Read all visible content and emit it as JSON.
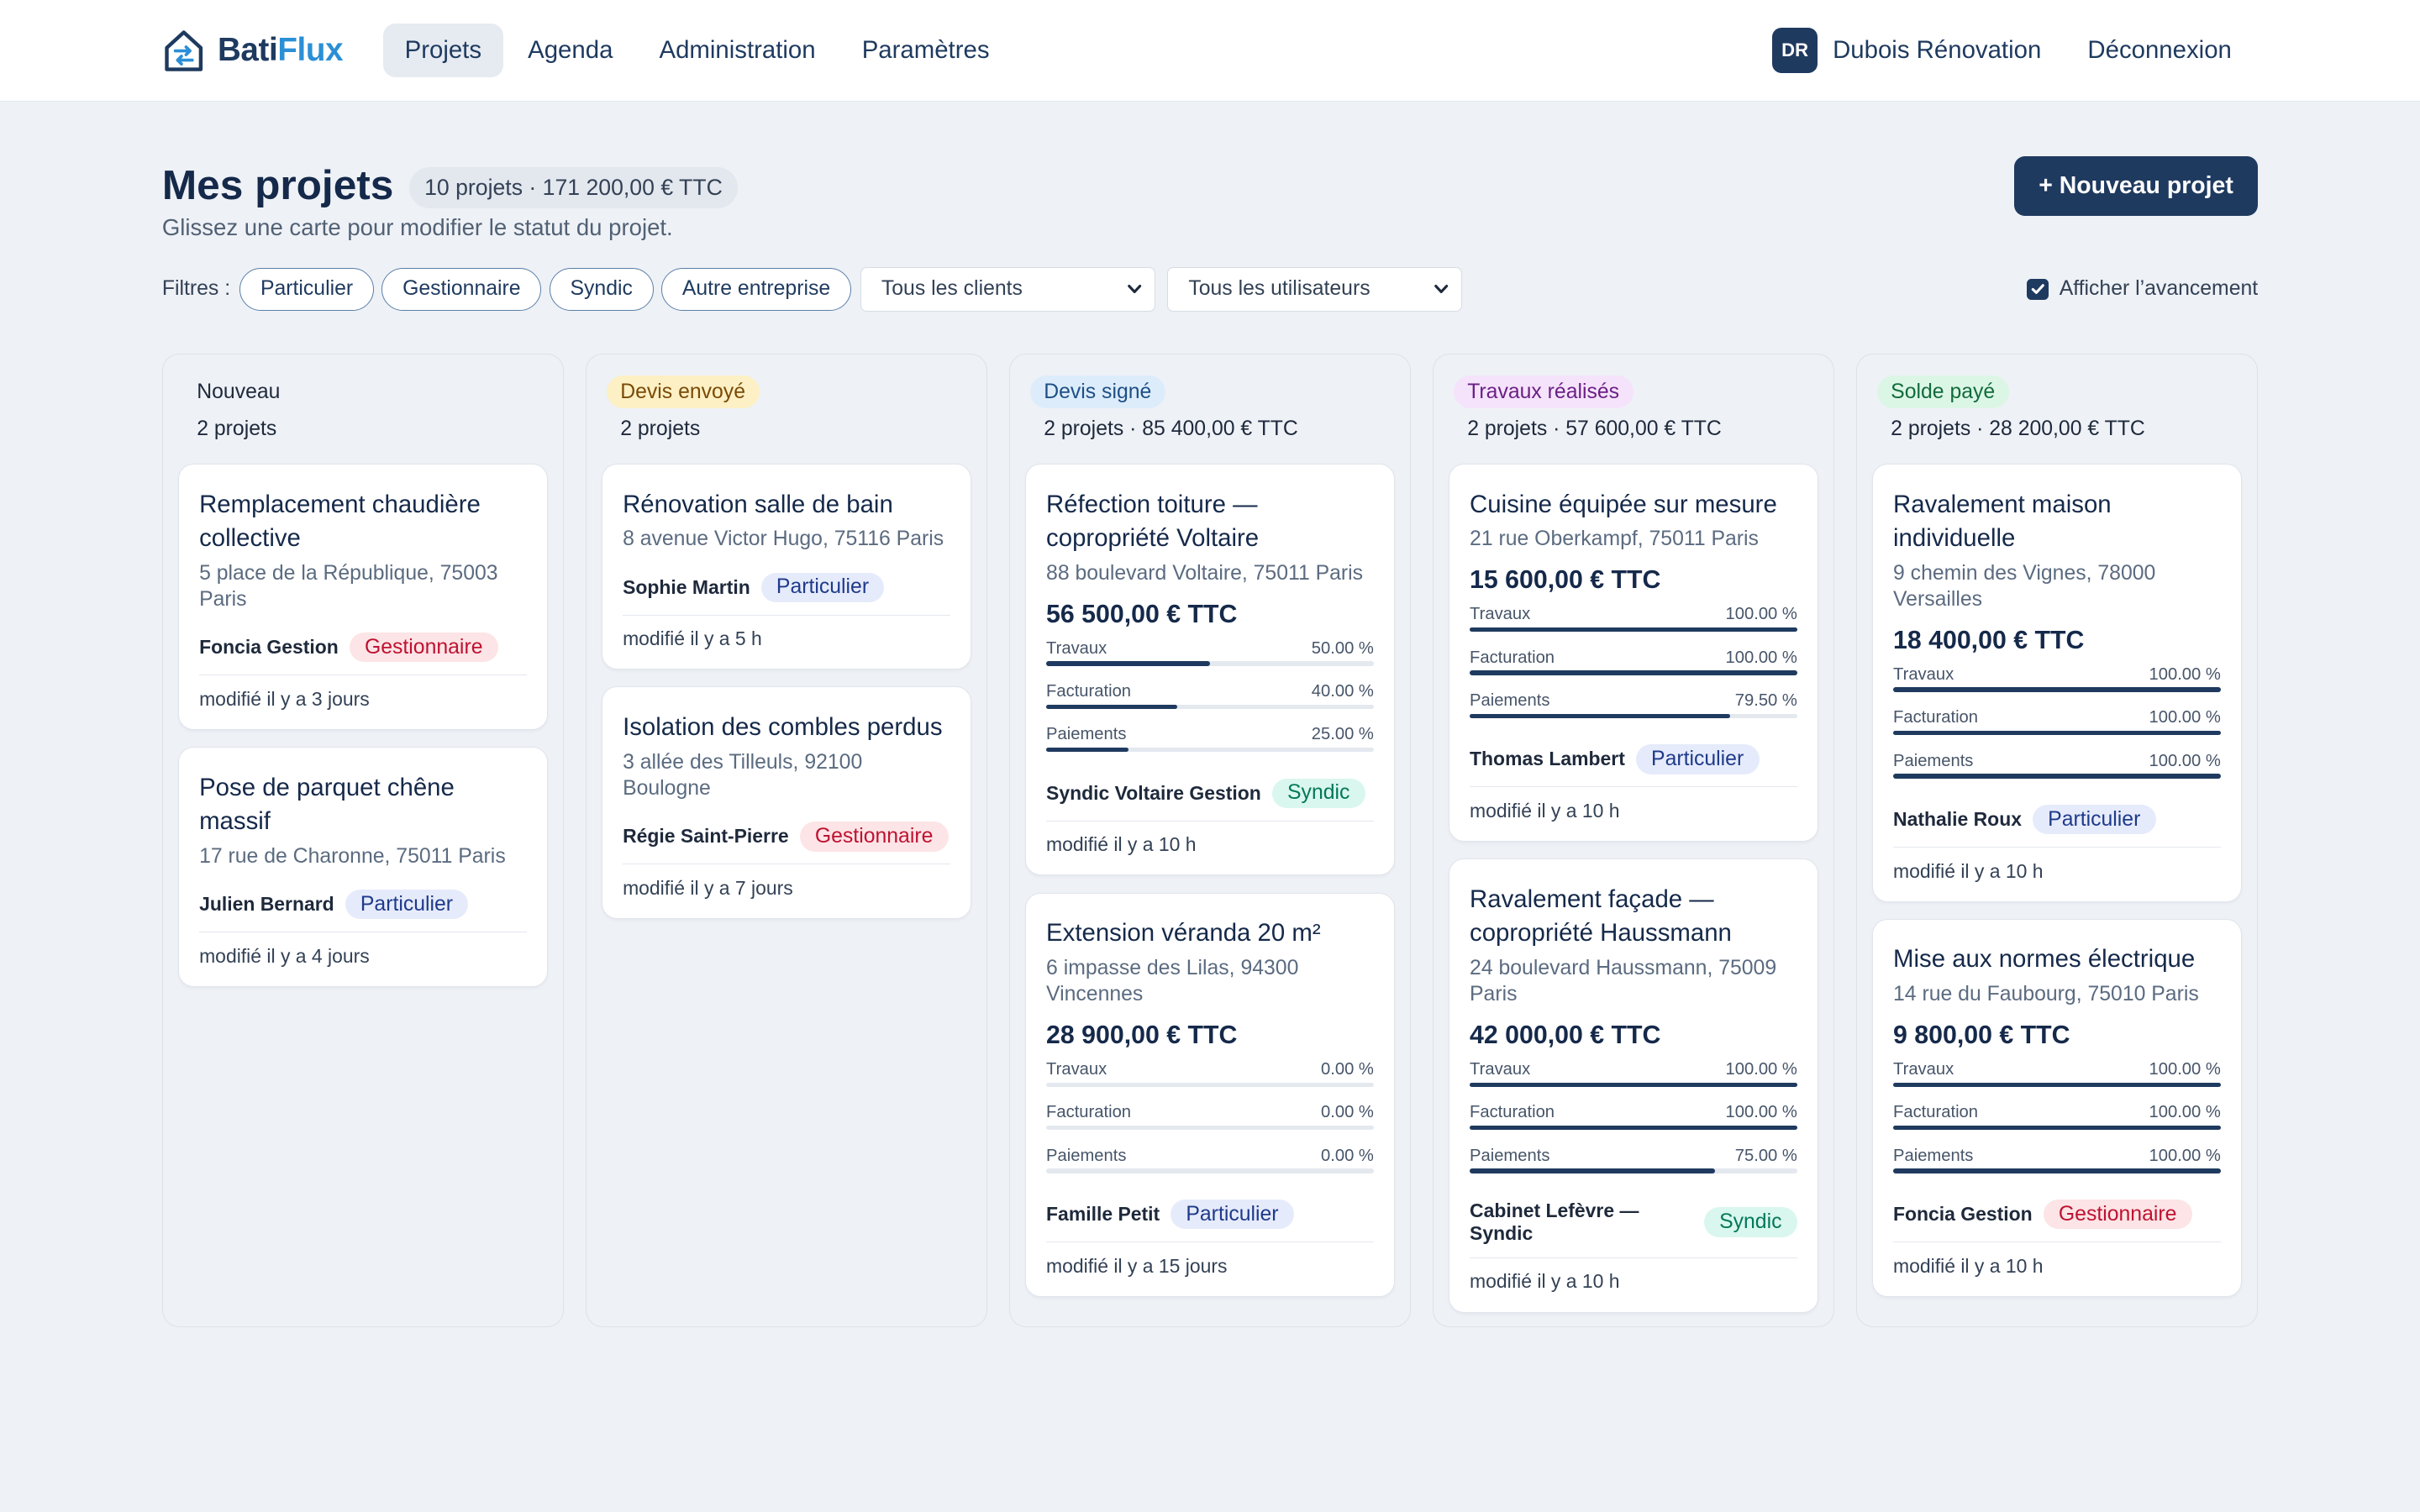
{
  "app": {
    "brand_part1": "Bati",
    "brand_part2": "Flux",
    "logo_icon": "house-sync-icon"
  },
  "nav": {
    "items": [
      {
        "label": "Projets",
        "active": true
      },
      {
        "label": "Agenda",
        "active": false
      },
      {
        "label": "Administration",
        "active": false
      },
      {
        "label": "Paramètres",
        "active": false
      }
    ]
  },
  "account": {
    "initials": "DR",
    "name": "Dubois Rénovation",
    "logout_label": "Déconnexion"
  },
  "header": {
    "title": "Mes projets",
    "summary": "10 projets · 171 200,00 € TTC",
    "subtitle": "Glissez une carte pour modifier le statut du projet.",
    "new_project_label": "+ Nouveau projet"
  },
  "filters": {
    "label": "Filtres :",
    "chips": [
      "Particulier",
      "Gestionnaire",
      "Syndic",
      "Autre entreprise"
    ],
    "client_select": "Tous les clients",
    "user_select": "Tous les utilisateurs",
    "show_progress_label": "Afficher l’avancement",
    "show_progress_checked": true
  },
  "colors": {
    "primary": "#1f3a5f",
    "accent": "#2b8fd6",
    "tag_particulier_bg": "#e6ebfb",
    "tag_gestionnaire_bg": "#fde4e6",
    "tag_syndic_bg": "#d9f7ef"
  },
  "columns": [
    {
      "status": "Nouveau",
      "badge_bg": "transparent",
      "badge_fg": "#1e293b",
      "count": "2 projets",
      "cards": [
        {
          "title": "Remplacement chaudière collective",
          "address": "5 place de la République, 75003 Paris",
          "amount": "",
          "progress": [],
          "client": "Foncia Gestion",
          "tag": "Gestionnaire",
          "tag_type": "gestionnaire",
          "modified": "modifié il y a 3 jours"
        },
        {
          "title": "Pose de parquet chêne massif",
          "address": "17 rue de Charonne, 75011 Paris",
          "amount": "",
          "progress": [],
          "client": "Julien Bernard",
          "tag": "Particulier",
          "tag_type": "particulier",
          "modified": "modifié il y a 4 jours"
        }
      ]
    },
    {
      "status": "Devis envoyé",
      "badge_bg": "#fdf0c4",
      "badge_fg": "#7a4a06",
      "count": "2 projets",
      "cards": [
        {
          "title": "Rénovation salle de bain",
          "address": "8 avenue Victor Hugo, 75116 Paris",
          "amount": "",
          "progress": [],
          "client": "Sophie Martin",
          "tag": "Particulier",
          "tag_type": "particulier",
          "modified": "modifié il y a 5 h"
        },
        {
          "title": "Isolation des combles perdus",
          "address": "3 allée des Tilleuls, 92100 Boulogne",
          "amount": "",
          "progress": [],
          "client": "Régie Saint-Pierre",
          "tag": "Gestionnaire",
          "tag_type": "gestionnaire",
          "modified": "modifié il y a 7 jours"
        }
      ]
    },
    {
      "status": "Devis signé",
      "badge_bg": "#dcecfb",
      "badge_fg": "#1e4f85",
      "count": "2 projets · 85 400,00 € TTC",
      "cards": [
        {
          "title": "Réfection toiture — copropriété Voltaire",
          "address": "88 boulevard Voltaire, 75011 Paris",
          "amount": "56 500,00 € TTC",
          "progress": [
            {
              "label": "Travaux",
              "text": "50.00 %",
              "value": 50
            },
            {
              "label": "Facturation",
              "text": "40.00 %",
              "value": 40
            },
            {
              "label": "Paiements",
              "text": "25.00 %",
              "value": 25
            }
          ],
          "client": "Syndic Voltaire Gestion",
          "tag": "Syndic",
          "tag_type": "syndic",
          "modified": "modifié il y a 10 h"
        },
        {
          "title": "Extension véranda 20 m²",
          "address": "6 impasse des Lilas, 94300 Vincennes",
          "amount": "28 900,00 € TTC",
          "progress": [
            {
              "label": "Travaux",
              "text": "0.00 %",
              "value": 0
            },
            {
              "label": "Facturation",
              "text": "0.00 %",
              "value": 0
            },
            {
              "label": "Paiements",
              "text": "0.00 %",
              "value": 0
            }
          ],
          "client": "Famille Petit",
          "tag": "Particulier",
          "tag_type": "particulier",
          "modified": "modifié il y a 15 jours"
        }
      ]
    },
    {
      "status": "Travaux réalisés",
      "badge_bg": "#f5e3fb",
      "badge_fg": "#6b1f86",
      "count": "2 projets · 57 600,00 € TTC",
      "cards": [
        {
          "title": "Cuisine équipée sur mesure",
          "address": "21 rue Oberkampf, 75011 Paris",
          "amount": "15 600,00 € TTC",
          "progress": [
            {
              "label": "Travaux",
              "text": "100.00 %",
              "value": 100
            },
            {
              "label": "Facturation",
              "text": "100.00 %",
              "value": 100
            },
            {
              "label": "Paiements",
              "text": "79.50 %",
              "value": 79.5
            }
          ],
          "client": "Thomas Lambert",
          "tag": "Particulier",
          "tag_type": "particulier",
          "modified": "modifié il y a 10 h"
        },
        {
          "title": "Ravalement façade — copropriété Haussmann",
          "address": "24 boulevard Haussmann, 75009 Paris",
          "amount": "42 000,00 € TTC",
          "progress": [
            {
              "label": "Travaux",
              "text": "100.00 %",
              "value": 100
            },
            {
              "label": "Facturation",
              "text": "100.00 %",
              "value": 100
            },
            {
              "label": "Paiements",
              "text": "75.00 %",
              "value": 75
            }
          ],
          "client": "Cabinet Lefèvre — Syndic",
          "tag": "Syndic",
          "tag_type": "syndic",
          "modified": "modifié il y a 10 h"
        }
      ]
    },
    {
      "status": "Solde payé",
      "badge_bg": "#dcf6e6",
      "badge_fg": "#126b3c",
      "count": "2 projets · 28 200,00 € TTC",
      "cards": [
        {
          "title": "Ravalement maison individuelle",
          "address": "9 chemin des Vignes, 78000 Versailles",
          "amount": "18 400,00 € TTC",
          "progress": [
            {
              "label": "Travaux",
              "text": "100.00 %",
              "value": 100
            },
            {
              "label": "Facturation",
              "text": "100.00 %",
              "value": 100
            },
            {
              "label": "Paiements",
              "text": "100.00 %",
              "value": 100
            }
          ],
          "client": "Nathalie Roux",
          "tag": "Particulier",
          "tag_type": "particulier",
          "modified": "modifié il y a 10 h"
        },
        {
          "title": "Mise aux normes électrique",
          "address": "14 rue du Faubourg, 75010 Paris",
          "amount": "9 800,00 € TTC",
          "progress": [
            {
              "label": "Travaux",
              "text": "100.00 %",
              "value": 100
            },
            {
              "label": "Facturation",
              "text": "100.00 %",
              "value": 100
            },
            {
              "label": "Paiements",
              "text": "100.00 %",
              "value": 100
            }
          ],
          "client": "Foncia Gestion",
          "tag": "Gestionnaire",
          "tag_type": "gestionnaire",
          "modified": "modifié il y a 10 h"
        }
      ]
    }
  ]
}
